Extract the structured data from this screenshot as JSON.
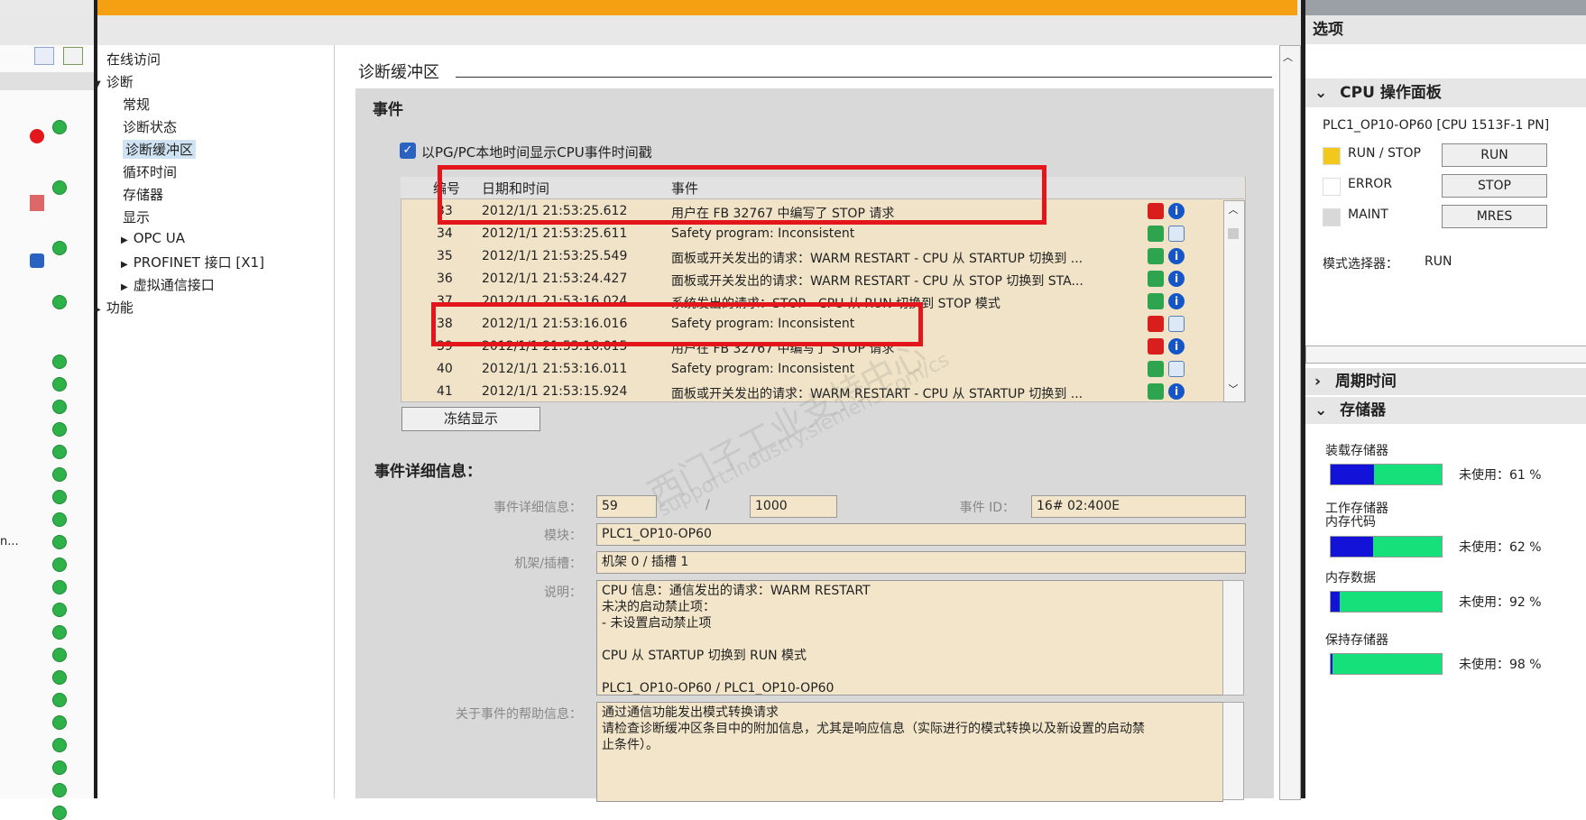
{
  "nav": {
    "items": [
      {
        "label": "在线访问",
        "indent": 0
      },
      {
        "label": "诊断",
        "indent": 0,
        "arrow": "▼"
      },
      {
        "label": "常规",
        "indent": 1
      },
      {
        "label": "诊断状态",
        "indent": 1
      },
      {
        "label": "诊断缓冲区",
        "indent": 1,
        "selected": true
      },
      {
        "label": "循环时间",
        "indent": 1
      },
      {
        "label": "存储器",
        "indent": 1
      },
      {
        "label": "显示",
        "indent": 1
      },
      {
        "label": "OPC UA",
        "indent": 1,
        "arrow": "▶"
      },
      {
        "label": "PROFINET 接口 [X1]",
        "indent": 1,
        "arrow": "▶"
      },
      {
        "label": "虚拟通信接口",
        "indent": 1,
        "arrow": "▶"
      },
      {
        "label": "功能",
        "indent": 0,
        "arrow": "▶"
      }
    ]
  },
  "main": {
    "section_title": "诊断缓冲区",
    "events_heading": "事件",
    "checkbox_label": "以PG/PC本地时间显示CPU事件时间戳",
    "columns": [
      "编号",
      "日期和时间",
      "事件"
    ],
    "rows": [
      {
        "num": "33",
        "datetime": "2012/1/1 21:53:25.612",
        "event": "用户在 FB 32767 中编写了 STOP 请求",
        "icon1": "red",
        "icon2": "info"
      },
      {
        "num": "34",
        "datetime": "2012/1/1 21:53:25.611",
        "event": "Safety program: Inconsistent",
        "icon1": "green",
        "icon2": "doc"
      },
      {
        "num": "35",
        "datetime": "2012/1/1 21:53:25.549",
        "event": "面板或开关发出的请求：WARM RESTART - CPU 从 STARTUP 切换到 ...",
        "icon1": "green",
        "icon2": "info"
      },
      {
        "num": "36",
        "datetime": "2012/1/1 21:53:24.427",
        "event": "面板或开关发出的请求：WARM RESTART - CPU 从 STOP 切换到 STA...",
        "icon1": "green",
        "icon2": "info"
      },
      {
        "num": "37",
        "datetime": "2012/1/1 21:53:16.024",
        "event": "系统发出的请求：STOP - CPU 从 RUN 切换到 STOP 模式",
        "icon1": "green",
        "icon2": "info"
      },
      {
        "num": "38",
        "datetime": "2012/1/1 21:53:16.016",
        "event": "Safety program: Inconsistent",
        "icon1": "red",
        "icon2": "doc"
      },
      {
        "num": "39",
        "datetime": "2012/1/1 21:53:16.015",
        "event": "用户在 FB 32767 中编写了 STOP 请求",
        "icon1": "red",
        "icon2": "info"
      },
      {
        "num": "40",
        "datetime": "2012/1/1 21:53:16.011",
        "event": "Safety program: Inconsistent",
        "icon1": "green",
        "icon2": "doc"
      },
      {
        "num": "41",
        "datetime": "2012/1/1 21:53:15.924",
        "event": "面板或开关发出的请求：WARM RESTART - CPU 从 STARTUP 切换到 ...",
        "icon1": "green",
        "icon2": "info"
      }
    ],
    "freeze_button": "冻结显示",
    "details_heading": "事件详细信息：",
    "details": {
      "detail_label": "事件详细信息：",
      "detail_value": "59",
      "separator": "/",
      "detail_total": "1000",
      "event_id_label": "事件 ID：",
      "event_id_value": "16# 02:400E",
      "module_label": "模块：",
      "module_value": "PLC1_OP10-OP60",
      "rack_label": "机架/插槽：",
      "rack_value": "机架 0 / 插槽 1",
      "desc_label": "说明：",
      "desc_lines": [
        "CPU 信息：通信发出的请求：WARM RESTART",
        "未决的启动禁止项：",
        "- 未设置启动禁止项",
        "",
        "CPU 从 STARTUP 切换到 RUN 模式",
        "",
        "PLC1_OP10-OP60 / PLC1_OP10-OP60"
      ],
      "help_label": "关于事件的帮助信息：",
      "help_lines": [
        "通过通信功能发出模式转换请求",
        "请检查诊断缓冲区条目中的附加信息，尤其是响应信息（实际进行的模式转换以及新设置的启动禁",
        "止条件）。"
      ]
    },
    "watermark": "西门子工业支持中心",
    "watermark_url": "support.industry.siemens.com/cs"
  },
  "right": {
    "options_title": "选项",
    "cpu_panel_title": "CPU 操作面板",
    "cpu_name": "PLC1_OP10-OP60 [CPU 1513F-1 PN]",
    "leds": [
      {
        "label": "RUN / STOP",
        "color": "#f2c81d",
        "button": "RUN"
      },
      {
        "label": "ERROR",
        "color": "#ffffff",
        "button": "STOP"
      },
      {
        "label": "MAINT",
        "color": "#d8d8d8",
        "button": "MRES"
      }
    ],
    "mode_label": "模式选择器：",
    "mode_value": "RUN",
    "cycle_title": "周期时间",
    "memory_title": "存储器",
    "memories": [
      {
        "label": "装载存储器",
        "free_text": "未使用：61 %",
        "free": 0.61
      },
      {
        "label": "工作存储器\n内存代码",
        "free_text": "未使用：62 %",
        "free": 0.62
      },
      {
        "label": "内存数据",
        "free_text": "未使用：92 %",
        "free": 0.92
      },
      {
        "label": "保持存储器",
        "free_text": "未使用：98 %",
        "free": 0.98
      }
    ]
  },
  "colors": {
    "accent": "#f5a012",
    "highlight": "#e3161b",
    "row_bg": "#f0e3c7"
  }
}
